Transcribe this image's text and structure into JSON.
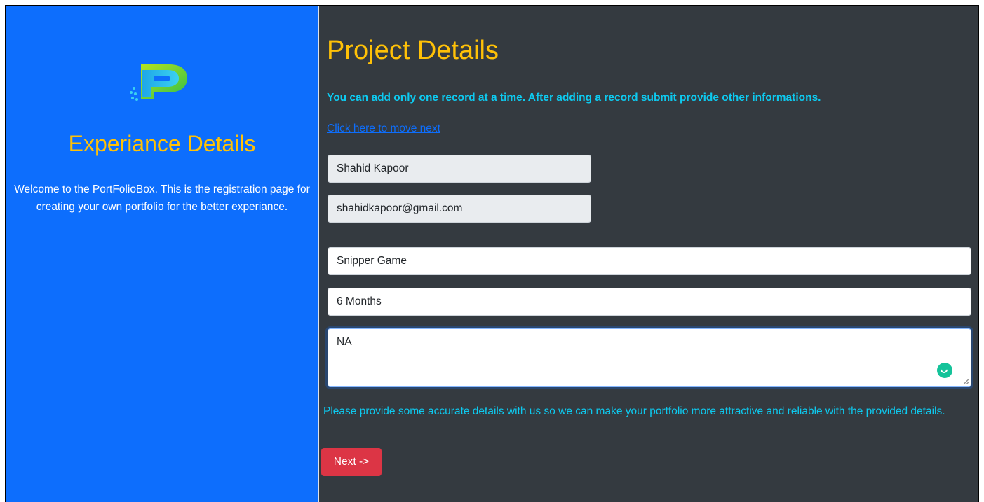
{
  "left": {
    "title": "Experiance Details",
    "welcome_text": "Welcome to the PortFolioBox. This is the registration page for creating your own portfolio for the better experiance.",
    "logo_icon": "portfoliobox-p-logo"
  },
  "main": {
    "title": "Project Details",
    "info_text": "You can add only one record at a time. After adding a record submit provide other informations.",
    "next_link": "Click here to move next",
    "fields": {
      "name": "Shahid Kapoor",
      "email": "shahidkapoor@gmail.com",
      "project_name": "Snipper Game",
      "duration": "6 Months",
      "description": "NA"
    },
    "help_text": "Please provide some accurate details with us so we can make your portfolio more attractive and reliable with the provided details.",
    "next_button": "Next ->"
  },
  "colors": {
    "left_bg": "#0d6efd",
    "right_bg": "#343a40",
    "title_accent": "#ffc107",
    "info_text": "#0dcaf0",
    "button": "#dc3545"
  }
}
